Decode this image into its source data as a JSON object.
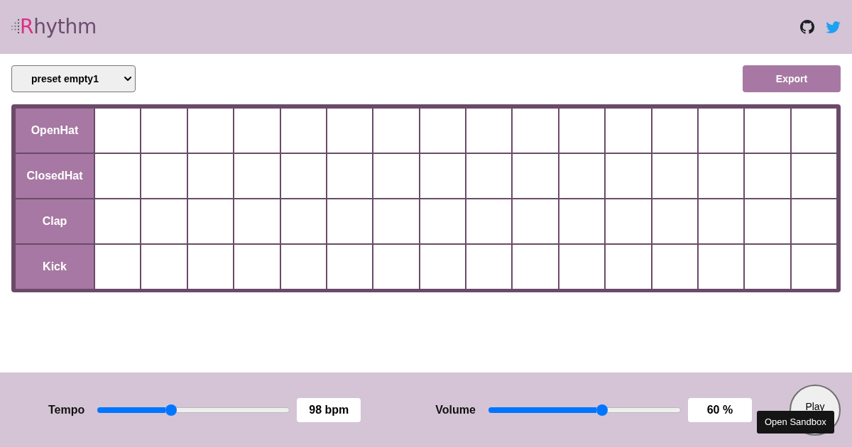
{
  "header": {
    "logo": "Rhythm"
  },
  "toolbar": {
    "preset": "preset empty1",
    "export_button": "Export"
  },
  "tracks": [
    {
      "name": "OpenHat",
      "steps": [
        {
          "on": false
        },
        {
          "on": false
        },
        {
          "on": false
        },
        {
          "on": false
        },
        {
          "on": false
        },
        {
          "on": false
        },
        {
          "on": false
        },
        {
          "on": false
        },
        {
          "on": false
        },
        {
          "on": false
        },
        {
          "on": false
        },
        {
          "on": false
        },
        {
          "on": false
        },
        {
          "on": false
        },
        {
          "on": false
        },
        {
          "on": false
        }
      ]
    },
    {
      "name": "ClosedHat",
      "steps": [
        {
          "on": false
        },
        {
          "on": false
        },
        {
          "on": false
        },
        {
          "on": false
        },
        {
          "on": false
        },
        {
          "on": false
        },
        {
          "on": false
        },
        {
          "on": false
        },
        {
          "on": false
        },
        {
          "on": false
        },
        {
          "on": false
        },
        {
          "on": false
        },
        {
          "on": false
        },
        {
          "on": false
        },
        {
          "on": false
        },
        {
          "on": false
        }
      ]
    },
    {
      "name": "Clap",
      "steps": [
        {
          "on": false
        },
        {
          "on": false
        },
        {
          "on": false
        },
        {
          "on": false
        },
        {
          "on": false
        },
        {
          "on": false
        },
        {
          "on": false
        },
        {
          "on": false
        },
        {
          "on": false
        },
        {
          "on": false
        },
        {
          "on": false
        },
        {
          "on": false
        },
        {
          "on": false
        },
        {
          "on": false
        },
        {
          "on": false
        },
        {
          "on": false
        }
      ]
    },
    {
      "name": "Kick",
      "steps": [
        {
          "on": false
        },
        {
          "on": false
        },
        {
          "on": false
        },
        {
          "on": false
        },
        {
          "on": false
        },
        {
          "on": false
        },
        {
          "on": false
        },
        {
          "on": false
        },
        {
          "on": false
        },
        {
          "on": false
        },
        {
          "on": false
        },
        {
          "on": false
        },
        {
          "on": false
        },
        {
          "on": false
        },
        {
          "on": false
        },
        {
          "on": false
        }
      ]
    }
  ],
  "controls": [
    {
      "label": "Tempo",
      "level": 0.38,
      "reading": "98 bpm"
    },
    {
      "label": "Volume",
      "level": 0.6,
      "reading": "60 %"
    }
  ],
  "play_button": "Play",
  "sandbox_tooltip": "Open Sandbox"
}
